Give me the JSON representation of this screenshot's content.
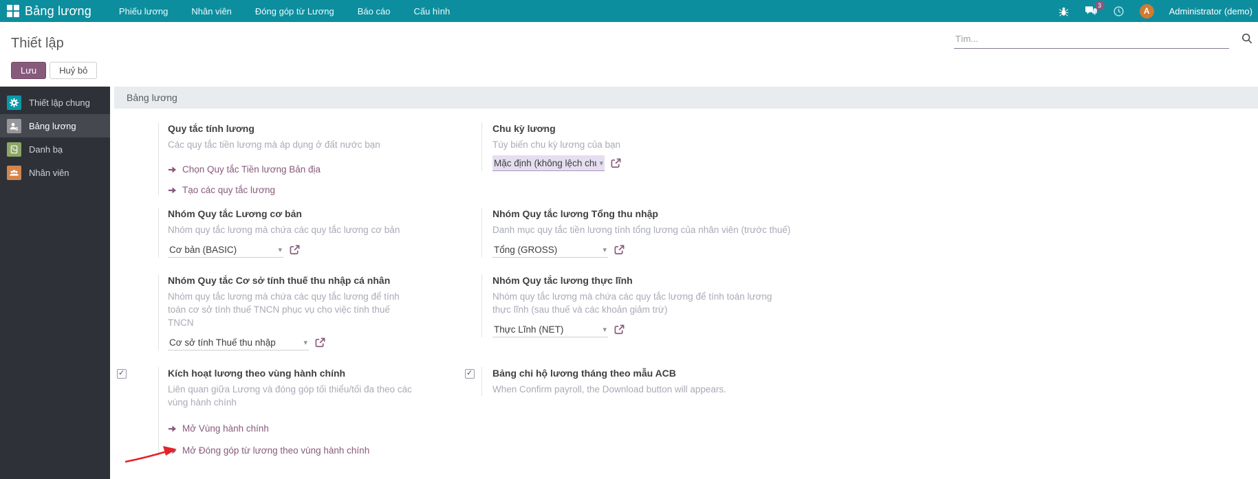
{
  "nav": {
    "brand": "Bảng lương",
    "items": [
      "Phiếu lương",
      "Nhân viên",
      "Đóng góp từ Lương",
      "Báo cáo",
      "Cấu hình"
    ],
    "messages_badge": "3",
    "avatar_letter": "A",
    "user": "Administrator (demo)"
  },
  "control_panel": {
    "title": "Thiết lập",
    "save_label": "Lưu",
    "discard_label": "Huỷ bỏ",
    "search_placeholder": "Tìm..."
  },
  "sidebar": {
    "items": [
      {
        "label": "Thiết lập chung",
        "icon": "gear-icon",
        "selected": false
      },
      {
        "label": "Bảng lương",
        "icon": "payroll-icon",
        "selected": true
      },
      {
        "label": "Danh bạ",
        "icon": "contacts-icon",
        "selected": false
      },
      {
        "label": "Nhân viên",
        "icon": "employees-icon",
        "selected": false
      }
    ]
  },
  "main": {
    "section_header": "Bảng lương",
    "blocks": {
      "salary_rules": {
        "title": "Quy tắc tính lương",
        "subtitle": "Các quy tắc tiền lương mà áp dụng ở đất nước bạn",
        "links": [
          "Chọn Quy tắc Tiền lương Bản địa",
          "Tạo các quy tắc lương"
        ]
      },
      "pay_cycle": {
        "title": "Chu kỳ lương",
        "subtitle": "Tùy biến chu kỳ lương của bạn",
        "select_value": "Mặc định (không lệch chu"
      },
      "basic_group": {
        "title": "Nhóm Quy tắc Lương cơ bản",
        "subtitle": "Nhóm quy tắc lương mà chứa các quy tắc lương cơ bản",
        "select_value": "Cơ bản (BASIC)"
      },
      "gross_group": {
        "title": "Nhóm Quy tắc lương Tổng thu nhập",
        "subtitle": "Danh mục quy tắc tiền lương tính tổng lương của nhân viên (trước thuế)",
        "select_value": "Tổng (GROSS)"
      },
      "tax_base_group": {
        "title": "Nhóm Quy tắc Cơ sở tính thuế thu nhập cá nhân",
        "subtitle": "Nhóm quy tắc lương mà chứa các quy tắc lương để tính toán cơ sở tính thuế TNCN phục vụ cho việc tính thuế TNCN",
        "select_value": "Cơ sở tính Thuế thu nhập"
      },
      "net_group": {
        "title": "Nhóm Quy tắc lương thực lĩnh",
        "subtitle": "Nhóm quy tắc lương mà chứa các quy tắc lương để tính toán lương thực lĩnh (sau thuế và các khoản giảm trừ)",
        "select_value": "Thực Lĩnh (NET)"
      },
      "admin_region": {
        "checked": true,
        "title": "Kích hoạt lương theo vùng hành chính",
        "subtitle": "Liên quan giữa Lương và đóng góp tối thiểu/tối đa theo các vùng hành chính",
        "links": [
          "Mở Vùng hành chính",
          "Mở Đóng góp từ lương theo vùng hành chính"
        ]
      },
      "acb_report": {
        "checked": true,
        "title": "Bảng chi hộ lương tháng theo mẫu ACB",
        "subtitle": "When Confirm payroll, the Download button will appears."
      }
    }
  },
  "colors": {
    "navbar": "#0d8e9e",
    "accent": "#875a7b",
    "sidebar_bg": "#2e3138",
    "badge": "#875a7b",
    "avatar": "#d07a33",
    "annotation_arrow": "#e1242a",
    "section_header_bg": "#e9ecef"
  }
}
